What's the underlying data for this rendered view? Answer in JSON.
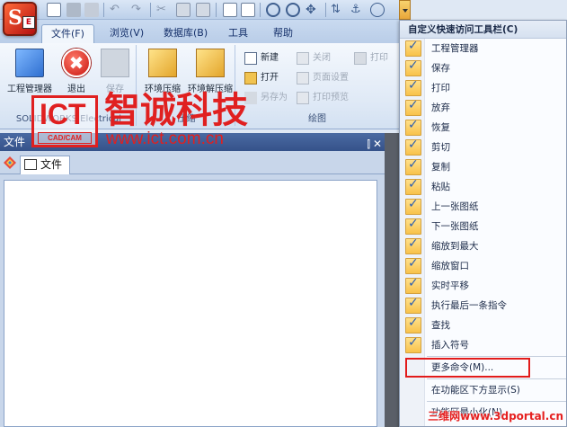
{
  "quick_access": {
    "dropdown_label": "自定义快速访问工具栏"
  },
  "ribbon": {
    "tabs": [
      {
        "label": "文件(F)",
        "active": true
      },
      {
        "label": "浏览(V)"
      },
      {
        "label": "数据库(B)"
      },
      {
        "label": "工具"
      },
      {
        "label": "帮助"
      }
    ],
    "groups": {
      "main": {
        "label": "SOLIDWORKS Electrical",
        "buttons": [
          "工程管理器",
          "退出",
          "保存"
        ]
      },
      "compress": {
        "label": "压缩",
        "buttons": [
          "环境压缩",
          "环境解压缩"
        ]
      },
      "drawing": {
        "label": "绘图",
        "buttons": [
          "新建",
          "打开",
          "另存为",
          "关闭",
          "页面设置",
          "打印预览",
          "打印"
        ]
      }
    }
  },
  "panel": {
    "title": "文件",
    "tab_label": "文件",
    "pin_icon": "pin-icon",
    "close_icon": "close-icon"
  },
  "menu": {
    "title": "自定义快速访问工具栏(C)",
    "checked_items": [
      "工程管理器",
      "保存",
      "打印",
      "放弃",
      "恢复",
      "剪切",
      "复制",
      "粘贴",
      "上一张图纸",
      "下一张图纸",
      "缩放到最大",
      "缩放窗口",
      "实时平移",
      "执行最后一条指令",
      "查找",
      "插入符号"
    ],
    "more_commands": "更多命令(M)...",
    "show_below": "在功能区下方显示(S)",
    "minimize": "功能区最小化(N)"
  },
  "watermarks": {
    "logo_text": "ICT",
    "logo_sub": "CAD/CAM",
    "company": "智诚科技",
    "url": "www.ict.com.cn",
    "site": "三维网www.3dportal.cn"
  },
  "colors": {
    "accent": "#3b5a91",
    "check": "#f8c24a",
    "highlight": "#e21b1b",
    "watermark": "#e02020"
  }
}
